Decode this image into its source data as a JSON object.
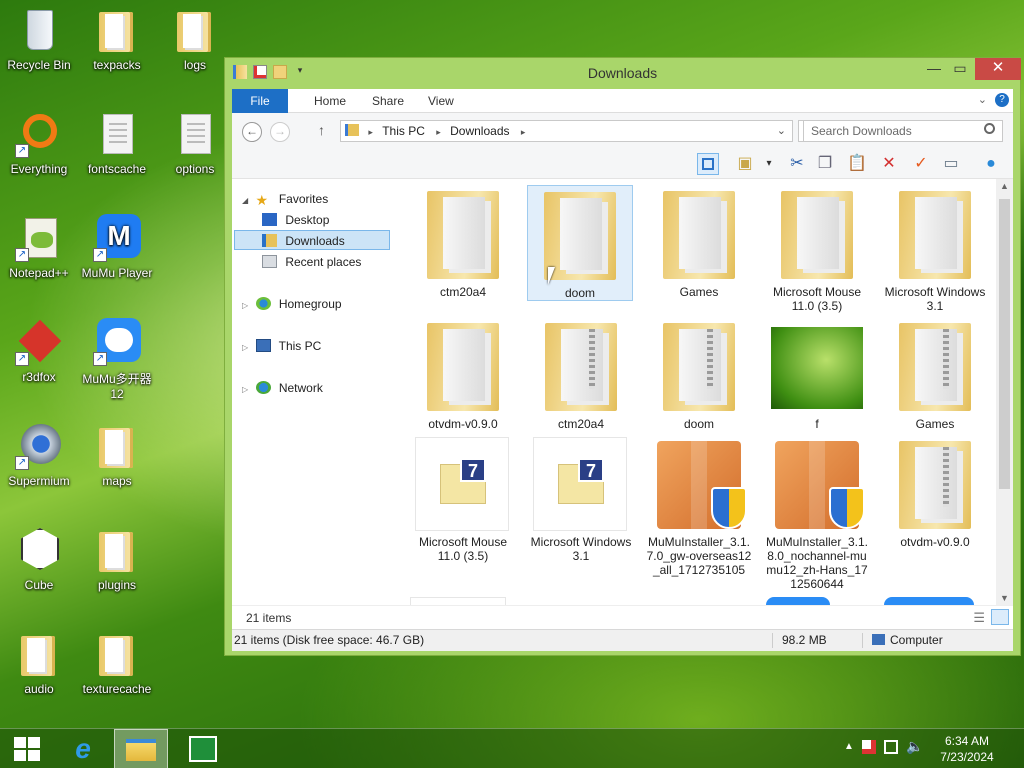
{
  "desktop": {
    "icons": [
      {
        "label": "Recycle Bin"
      },
      {
        "label": "texpacks"
      },
      {
        "label": "logs"
      },
      {
        "label": "Everything"
      },
      {
        "label": "fontscache"
      },
      {
        "label": "options"
      },
      {
        "label": "Notepad++"
      },
      {
        "label": "MuMu Player"
      },
      {
        "label": "r3dfox"
      },
      {
        "label": "MuMu多开器12"
      },
      {
        "label": "Supermium"
      },
      {
        "label": "maps"
      },
      {
        "label": "Cube"
      },
      {
        "label": "plugins"
      },
      {
        "label": "audio"
      },
      {
        "label": "texturecache"
      }
    ]
  },
  "window": {
    "title": "Downloads",
    "tabs": {
      "file": "File",
      "home": "Home",
      "share": "Share",
      "view": "View"
    },
    "address": {
      "root": "This PC",
      "folder": "Downloads"
    },
    "search_placeholder": "Search Downloads",
    "nav": {
      "favorites": "Favorites",
      "desktop": "Desktop",
      "downloads": "Downloads",
      "recent": "Recent places",
      "homegroup": "Homegroup",
      "thispc": "This PC",
      "network": "Network"
    },
    "files": [
      {
        "name": "ctm20a4",
        "type": "folder"
      },
      {
        "name": "doom",
        "type": "folder",
        "selected": true
      },
      {
        "name": "Games",
        "type": "folder"
      },
      {
        "name": "Microsoft Mouse 11.0 (3.5)",
        "type": "folder"
      },
      {
        "name": "Microsoft Windows 3.1",
        "type": "folder"
      },
      {
        "name": "otvdm-v0.9.0",
        "type": "folder"
      },
      {
        "name": "ctm20a4",
        "type": "zip"
      },
      {
        "name": "doom",
        "type": "zip"
      },
      {
        "name": "f",
        "type": "image"
      },
      {
        "name": "Games",
        "type": "zip"
      },
      {
        "name": "Microsoft Mouse 11.0 (3.5)",
        "type": "7z"
      },
      {
        "name": "Microsoft Windows 3.1",
        "type": "7z"
      },
      {
        "name": "MuMuInstaller_3.1.7.0_gw-overseas12_all_1712735105",
        "type": "installer"
      },
      {
        "name": "MuMuInstaller_3.1.8.0_nochannel-mumu12_zh-Hans_1712560644",
        "type": "installer"
      },
      {
        "name": "otvdm-v0.9.0",
        "type": "zip"
      }
    ],
    "item_count": "21 items",
    "status_left": "21 items (Disk free space: 46.7 GB)",
    "status_size": "98.2 MB",
    "status_location": "Computer"
  },
  "taskbar": {
    "time": "6:34 AM",
    "date": "7/23/2024"
  },
  "colors": {
    "window_frame": "#a9d66a",
    "file_tab": "#1d6fc6",
    "close_button": "#c94a45",
    "selection": "#cce4f7"
  }
}
